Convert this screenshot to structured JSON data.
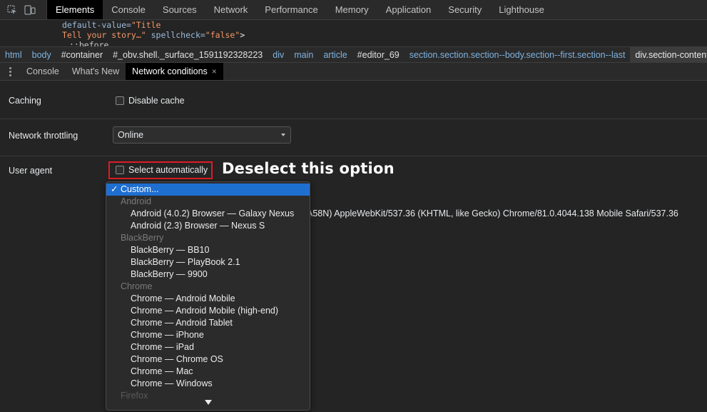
{
  "top_tabs": [
    "Elements",
    "Console",
    "Sources",
    "Network",
    "Performance",
    "Memory",
    "Application",
    "Security",
    "Lighthouse"
  ],
  "code": {
    "line1_attr": "default-value=",
    "line1_val": "\"Title",
    "line2_val": "Tell your story…\"",
    "line2_attr": " spellcheck=",
    "line2_val2": "\"false\"",
    "line2_end": ">",
    "line3": "::before"
  },
  "breadcrumbs": [
    "html",
    "body",
    "#container",
    "#_obv.shell._surface_1591192328223",
    "div",
    "main",
    "article",
    "#editor_69",
    "section.section.section--body.section--first.section--last",
    "div.section-content"
  ],
  "drawer_tabs": {
    "console": "Console",
    "whats_new": "What's New",
    "network_conditions": "Network conditions",
    "close_glyph": "×"
  },
  "panel": {
    "caching_label": "Caching",
    "disable_cache_label": "Disable cache",
    "throttling_label": "Network throttling",
    "throttling_value": "Online",
    "user_agent_label": "User agent",
    "select_automatically_label": "Select automatically",
    "ua_string": "A58N) AppleWebKit/537.36 (KHTML, like Gecko) Chrome/81.0.4044.138 Mobile Safari/537.36"
  },
  "annotation": "Deselect this option",
  "dropdown": {
    "selected": "Custom...",
    "tick": "✓",
    "groups": [
      {
        "name": "Android",
        "items": [
          "Android (4.0.2) Browser — Galaxy Nexus",
          "Android (2.3) Browser — Nexus S"
        ]
      },
      {
        "name": "BlackBerry",
        "items": [
          "BlackBerry — BB10",
          "BlackBerry — PlayBook 2.1",
          "BlackBerry — 9900"
        ]
      },
      {
        "name": "Chrome",
        "items": [
          "Chrome — Android Mobile",
          "Chrome — Android Mobile (high-end)",
          "Chrome — Android Tablet",
          "Chrome — iPhone",
          "Chrome — iPad",
          "Chrome — Chrome OS",
          "Chrome — Mac",
          "Chrome — Windows"
        ]
      }
    ],
    "partial_group": "Firefox"
  },
  "colors": {
    "accent_blue": "#1f6fd1",
    "highlight_red": "#e01b24",
    "link_blue": "#7fb3e0"
  },
  "icons": [
    "inspect-element-icon",
    "device-toolbar-icon",
    "kebab-menu-icon",
    "dropdown-caret-icon",
    "scroll-down-arrow-icon"
  ]
}
